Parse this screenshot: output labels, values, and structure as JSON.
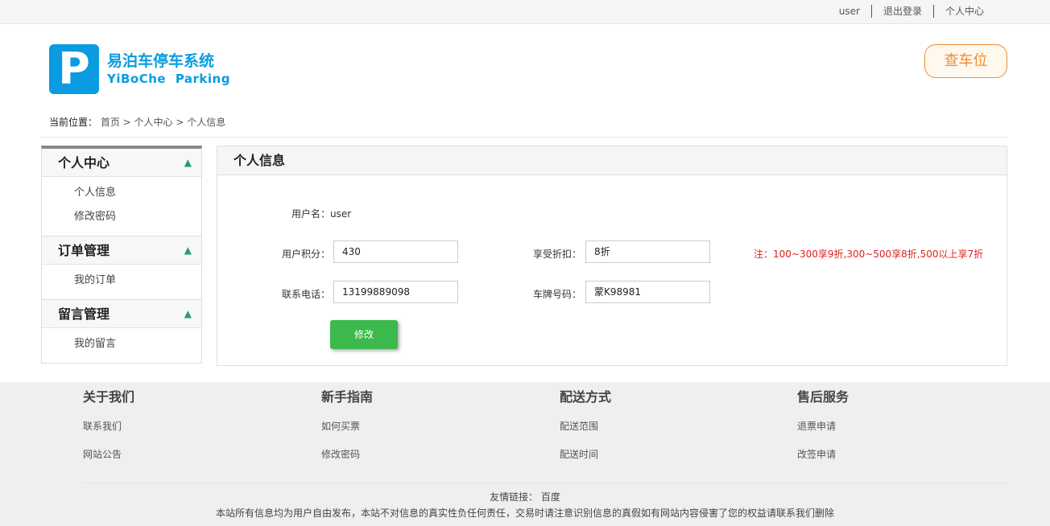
{
  "topbar": {
    "user": "user",
    "logout": "退出登录",
    "profile": "个人中心"
  },
  "logo": {
    "letter": "P",
    "cn": "易泊车停车系统",
    "en": "YiBoChe Parking"
  },
  "find_spot": "查车位",
  "breadcrumb": {
    "label": "当前位置：",
    "path": "首页 > 个人中心 > 个人信息"
  },
  "sidebar": [
    {
      "title": "个人中心",
      "items": [
        "个人信息",
        "修改密码"
      ]
    },
    {
      "title": "订单管理",
      "items": [
        "我的订单"
      ]
    },
    {
      "title": "留言管理",
      "items": [
        "我的留言"
      ]
    }
  ],
  "panel": {
    "title": "个人信息",
    "username_label": "用户名：",
    "username": "user",
    "points_label": "用户积分：",
    "points": "430",
    "discount_label": "享受折扣：",
    "discount": "8折",
    "note": "注：100~300享9折,300~500享8折,500以上享7折",
    "phone_label": "联系电话：",
    "phone": "13199889098",
    "plate_label": "车牌号码：",
    "plate": "蒙K98981",
    "edit": "修改"
  },
  "footer": {
    "columns": [
      {
        "title": "关于我们",
        "items": [
          "联系我们",
          "网站公告"
        ]
      },
      {
        "title": "新手指南",
        "items": [
          "如何买票",
          "修改密码"
        ]
      },
      {
        "title": "配送方式",
        "items": [
          "配送范围",
          "配送时间"
        ]
      },
      {
        "title": "售后服务",
        "items": [
          "退票申请",
          "改签申请"
        ]
      }
    ],
    "links_label": "友情链接：",
    "link": "百度",
    "notice": "本站所有信息均为用户自由发布，本站不对信息的真实性负任何责任，交易时请注意识别信息的真假如有网站内容侵害了您的权益请联系我们删除"
  }
}
